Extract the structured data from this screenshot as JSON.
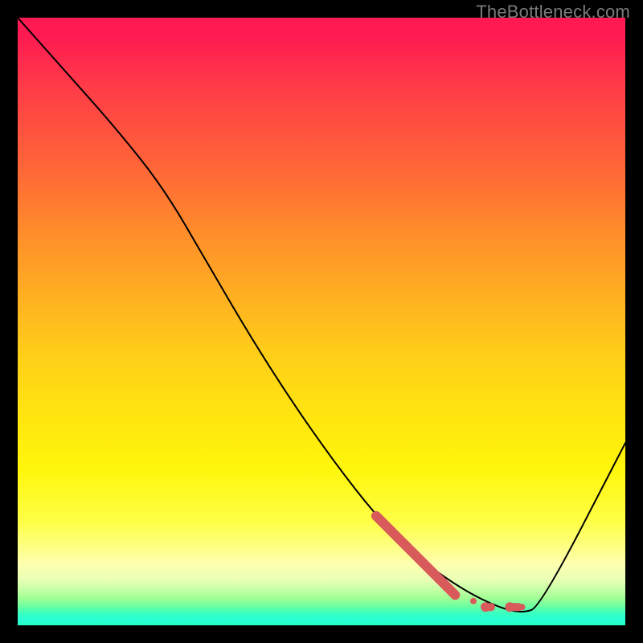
{
  "watermark": "TheBottleneck.com",
  "chart_data": {
    "type": "line",
    "title": "",
    "xlabel": "",
    "ylabel": "",
    "xlim": [
      0,
      100
    ],
    "ylim": [
      0,
      100
    ],
    "grid": false,
    "legend": false,
    "series": [
      {
        "name": "curve",
        "color": "#000000",
        "x": [
          0,
          8,
          16,
          24,
          31,
          38,
          45,
          52,
          59,
          66,
          73,
          79,
          83,
          86,
          100
        ],
        "values": [
          100,
          91,
          82,
          72,
          60,
          48,
          37,
          27,
          18,
          11,
          6,
          3,
          2,
          3,
          30
        ]
      },
      {
        "name": "highlight-dots",
        "color": "#d85a5a",
        "x": [
          59,
          63,
          67,
          70,
          72,
          75,
          77,
          78,
          81,
          83
        ],
        "values": [
          18,
          14,
          10,
          7,
          5,
          4,
          3,
          3,
          3,
          3
        ]
      }
    ]
  }
}
